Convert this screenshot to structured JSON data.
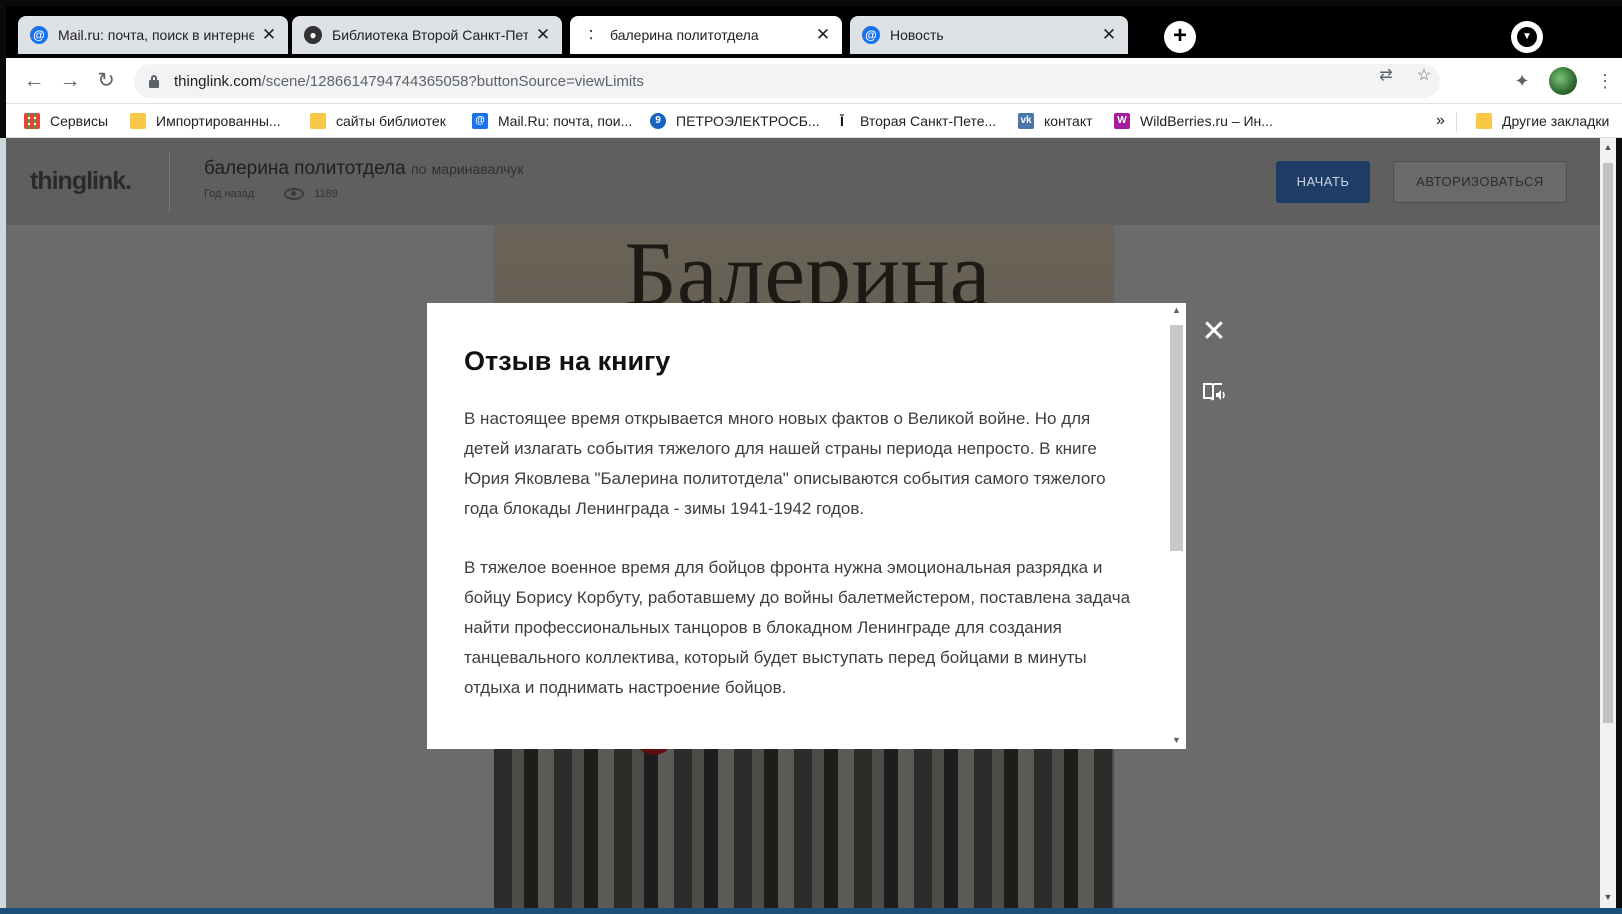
{
  "tabs": [
    {
      "title": "Mail.ru: почта, поиск в интернет",
      "close": "✕",
      "icon": "mail-at-icon"
    },
    {
      "title": "Библиотека Второй Санкт-Петер",
      "close": "✕",
      "icon": "library-icon"
    },
    {
      "title": "балерина политотдела",
      "close": "✕",
      "icon": "thinglink-icon",
      "active": true
    },
    {
      "title": "Новость",
      "close": "✕",
      "icon": "mail-at-icon"
    }
  ],
  "new_tab": "+",
  "address": {
    "host": "thinglink.com",
    "path": "/scene/1286614794744365058?buttonSource=viewLimits"
  },
  "bookmarks": [
    {
      "label": "Сервисы",
      "icon": "apps-icon"
    },
    {
      "label": "Импортированны...",
      "icon": "folder-icon"
    },
    {
      "label": "сайты библиотек",
      "icon": "folder-icon"
    },
    {
      "label": "Mail.Ru: почта, пои...",
      "icon": "mail-at-icon"
    },
    {
      "label": "ПЕТРОЭЛЕКТРОСБ...",
      "icon": "petroelektrosbyt-icon"
    },
    {
      "label": "Вторая Санкт-Пете...",
      "icon": "library-icon"
    },
    {
      "label": "контакт",
      "icon": "vk-icon"
    },
    {
      "label": "WildBerries.ru – Ин...",
      "icon": "wildberries-icon"
    },
    {
      "label": "Другие закладки",
      "icon": "folder-icon"
    }
  ],
  "bookmarks_more": "»",
  "thinglink": {
    "logo": "thinglink.",
    "scene_title": "балерина политотдела",
    "by_prefix": "по",
    "author": "маринавалчук",
    "age": "Год назад",
    "views": "1189",
    "start_button": "НАЧАТЬ",
    "login_button": "АВТОРИЗОВАТЬСЯ",
    "cover_title": "Балерина"
  },
  "modal": {
    "title": "Отзыв на книгу",
    "paragraphs": [
      "В настоящее время открывается много новых фактов о Великой войне. Но для детей излагать события тяжелого для нашей страны периода непросто. В книге Юрия Яковлева \"Балерина политотдела\" описываются события самого тяжелого года блокады Ленинграда - зимы 1941-1942 годов.",
      "В тяжелое военное время для бойцов фронта нужна эмоциональная разрядка и бойцу Борису Корбуту, работавшему до войны балетмейстером, поставлена задача найти профессиональных танцоров в блокадном Ленинграде для создания танцевального коллектива, который будет выступать перед бойцами в минуты отдыха и поднимать настроение бойцов."
    ],
    "close": "✕",
    "audio_icon": "immersive-reader-icon"
  },
  "colors": {
    "start_button": "#1f3c66",
    "overlay": "#6b6b6b"
  }
}
